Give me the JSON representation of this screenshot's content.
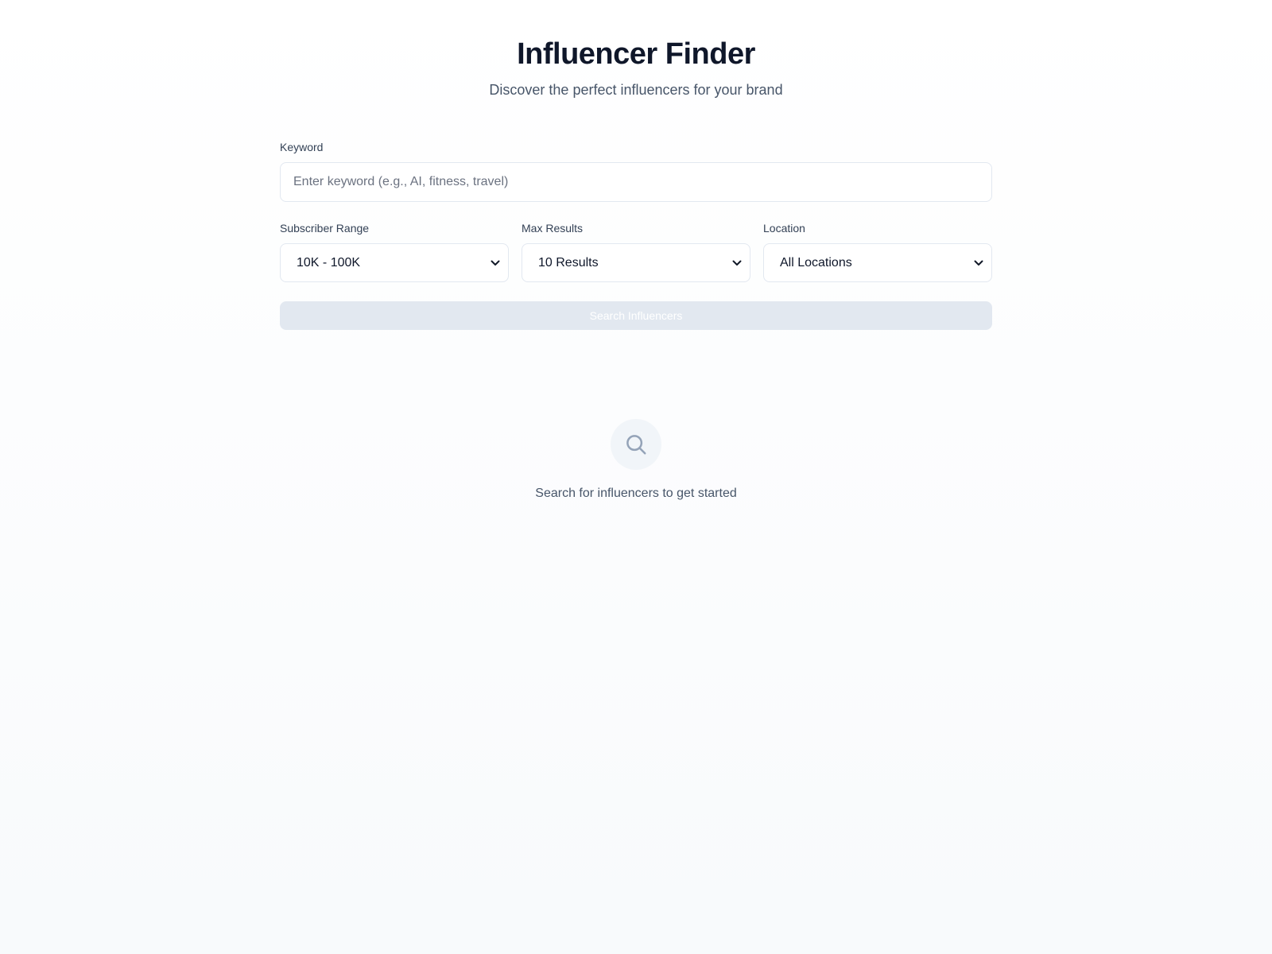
{
  "header": {
    "title": "Influencer Finder",
    "subtitle": "Discover the perfect influencers for your brand"
  },
  "form": {
    "keyword": {
      "label": "Keyword",
      "value": "",
      "placeholder": "Enter keyword (e.g., AI, fitness, travel)"
    },
    "subscriber_range": {
      "label": "Subscriber Range",
      "selected": "10K - 100K"
    },
    "max_results": {
      "label": "Max Results",
      "selected": "10 Results"
    },
    "location": {
      "label": "Location",
      "selected": "All Locations"
    },
    "search_button": {
      "label": "Search Influencers",
      "disabled": true
    }
  },
  "empty_state": {
    "icon": "search-icon",
    "message": "Search for influencers to get started"
  },
  "colors": {
    "title": "#0f172a",
    "subtitle": "#475569",
    "border": "#e2e8f0",
    "button_disabled_bg": "#e2e8f0",
    "icon_bg": "#f1f5f9",
    "icon": "#94a3b8"
  }
}
